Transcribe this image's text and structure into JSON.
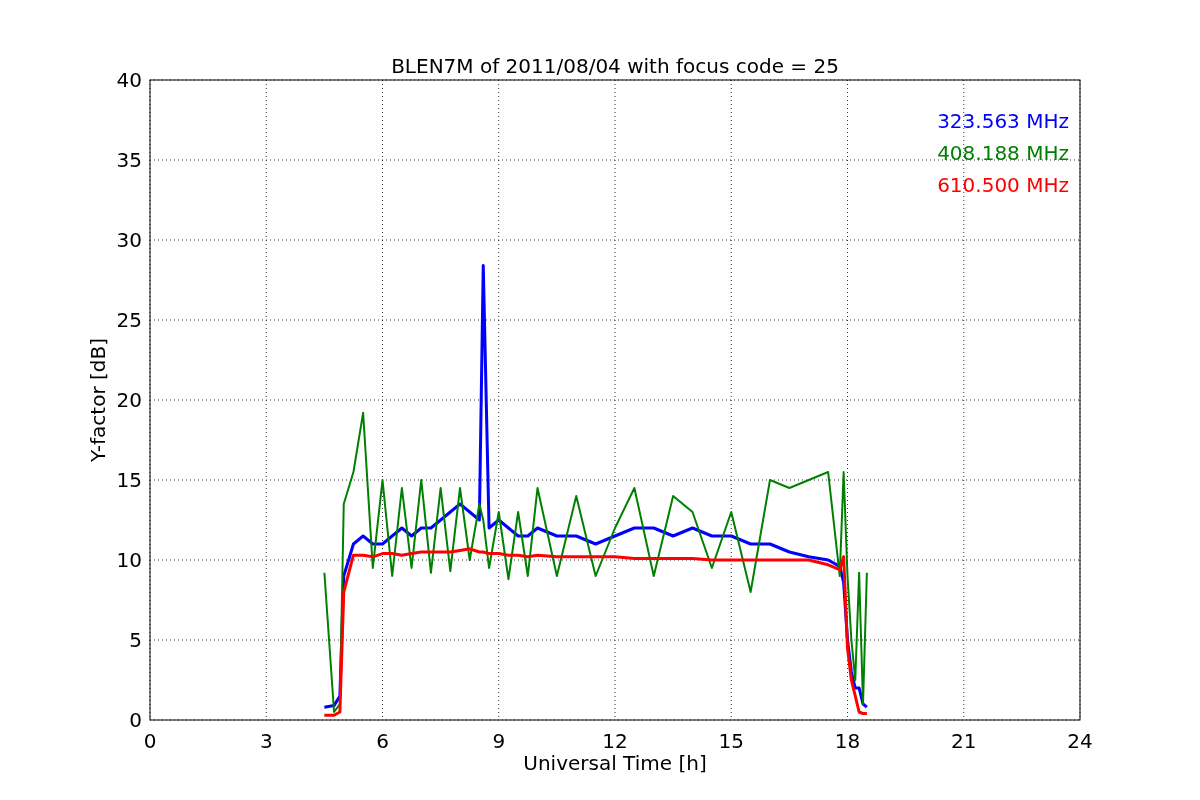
{
  "chart_data": {
    "type": "line",
    "title": "BLEN7M of 2011/08/04 with focus code = 25",
    "xlabel": "Universal Time [h]",
    "ylabel": "Y-factor [dB]",
    "x": [
      4.5,
      4.75,
      4.9,
      5.0,
      5.25,
      5.5,
      5.75,
      6.0,
      6.25,
      6.5,
      6.75,
      7.0,
      7.25,
      7.5,
      7.75,
      8.0,
      8.25,
      8.5,
      8.6,
      8.75,
      9.0,
      9.25,
      9.5,
      9.75,
      10.0,
      10.5,
      11.0,
      11.5,
      12.0,
      12.5,
      13.0,
      13.5,
      14.0,
      14.5,
      15.0,
      15.5,
      16.0,
      16.5,
      17.0,
      17.5,
      17.8,
      17.9,
      18.0,
      18.1,
      18.2,
      18.3,
      18.4,
      18.5
    ],
    "series": [
      {
        "name": "323.563 MHz",
        "color": "#0000ff",
        "values": [
          0.8,
          0.9,
          1.5,
          9,
          11,
          11.5,
          11,
          11,
          11.5,
          12,
          11.5,
          12,
          12,
          12.5,
          13,
          13.5,
          13,
          12.5,
          28.4,
          12,
          12.5,
          12,
          11.5,
          11.5,
          12,
          11.5,
          11.5,
          11,
          11.5,
          12,
          12,
          11.5,
          12,
          11.5,
          11.5,
          11,
          11,
          10.5,
          10.2,
          10,
          9.6,
          8.6,
          5,
          3,
          2,
          2,
          1,
          0.8
        ]
      },
      {
        "name": "408.188 MHz",
        "color": "#008000",
        "values": [
          9.2,
          0.5,
          1,
          13.5,
          15.5,
          19.2,
          9.5,
          15,
          9,
          14.5,
          9.5,
          15,
          9.2,
          14.5,
          9.3,
          14.5,
          10,
          13.5,
          12.5,
          9.5,
          13,
          8.8,
          13,
          9,
          14.5,
          9,
          14,
          9,
          12,
          14.5,
          9,
          14,
          13,
          9.5,
          13,
          8,
          15,
          14.5,
          15,
          15.5,
          9,
          15.5,
          9,
          5,
          2.5,
          9.2,
          1,
          9.2
        ]
      },
      {
        "name": "610.500 MHz",
        "color": "#ff0000",
        "values": [
          0.3,
          0.3,
          0.5,
          8,
          10.3,
          10.3,
          10.2,
          10.4,
          10.4,
          10.3,
          10.4,
          10.5,
          10.5,
          10.5,
          10.5,
          10.6,
          10.7,
          10.5,
          10.5,
          10.4,
          10.4,
          10.3,
          10.3,
          10.2,
          10.3,
          10.2,
          10.2,
          10.2,
          10.2,
          10.1,
          10.1,
          10.1,
          10.1,
          10,
          10,
          10,
          10,
          10,
          10,
          9.7,
          9.4,
          10.2,
          4.5,
          2.5,
          1.5,
          0.5,
          0.4,
          0.4
        ]
      }
    ],
    "xlim": [
      0,
      24
    ],
    "ylim": [
      0,
      40
    ],
    "xticks": [
      0,
      3,
      6,
      9,
      12,
      15,
      18,
      21,
      24
    ],
    "yticks": [
      0,
      5,
      10,
      15,
      20,
      25,
      30,
      35,
      40
    ],
    "grid": true
  }
}
